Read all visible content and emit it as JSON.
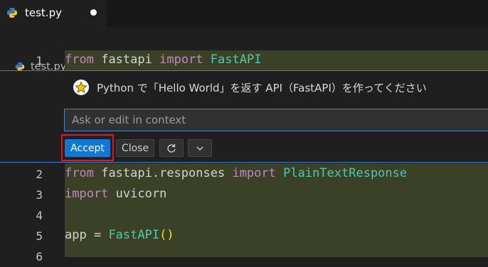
{
  "tab": {
    "file_name": "test.py",
    "modified": true
  },
  "breadcrumb": {
    "file_name": "test.py"
  },
  "code_lines": [
    {
      "number": "1",
      "text": "from fastapi import FastAPI"
    },
    {
      "number": "2",
      "text": "from fastapi.responses import PlainTextResponse"
    },
    {
      "number": "3",
      "text": "import uvicorn"
    },
    {
      "number": "4",
      "text": ""
    },
    {
      "number": "5",
      "text": "app = FastAPI()"
    },
    {
      "number": "6",
      "text": ""
    }
  ],
  "inline_chat": {
    "prompt": "Python で「Hello World」を返す API（FastAPI）を作ってください",
    "input_placeholder": "Ask or edit in context",
    "accept_label": "Accept",
    "close_label": "Close"
  },
  "icons": {
    "tab_file": "python-file-icon",
    "breadcrumb_file": "python-file-icon",
    "chat_avatar": "star-avatar-icon",
    "rerun": "refresh-icon",
    "more": "chevron-down-icon"
  },
  "colors": {
    "editor_bg": "#1f1f1f",
    "inserted_line_bg": "#3a4126",
    "accent": "#0e78d4",
    "highlight_box": "#e2141c",
    "keyword": "#c586c0"
  }
}
